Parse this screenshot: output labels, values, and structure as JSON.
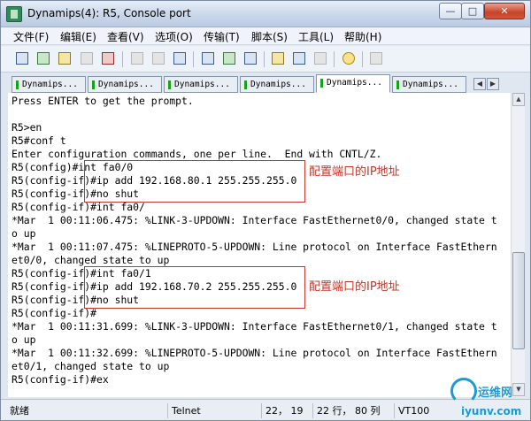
{
  "window": {
    "title": "Dynamips(4): R5, Console port",
    "buttons": {
      "minimize": "—",
      "maximize": "□",
      "close": "✕"
    }
  },
  "menu": {
    "items": [
      "文件(F)",
      "编辑(E)",
      "查看(V)",
      "选项(O)",
      "传输(T)",
      "脚本(S)",
      "工具(L)",
      "帮助(H)"
    ]
  },
  "toolbar": {
    "icons": [
      "connect-icon",
      "quick-connect-icon",
      "connect-tab-icon",
      "reconnect-icon",
      "disconnect-icon",
      "copy-icon",
      "paste-icon",
      "find-icon",
      "print-setup-icon",
      "print-icon",
      "print-screen-icon",
      "session-options-icon",
      "global-options-icon",
      "keymap-icon",
      "help-icon",
      "dim-icon"
    ]
  },
  "tabs": [
    {
      "label": "Dynamips...",
      "active": false
    },
    {
      "label": "Dynamips...",
      "active": false
    },
    {
      "label": "Dynamips...",
      "active": false
    },
    {
      "label": "Dynamips...",
      "active": false
    },
    {
      "label": "Dynamips...",
      "active": true
    },
    {
      "label": "Dynamips...",
      "active": false
    }
  ],
  "console": {
    "lines": [
      "Press ENTER to get the prompt.",
      "",
      "R5>en",
      "R5#conf t",
      "Enter configuration commands, one per line.  End with CNTL/Z.",
      "R5(config)#int fa0/0",
      "R5(config-if)#ip add 192.168.80.1 255.255.255.0",
      "R5(config-if)#no shut",
      "R5(config-if)#int fa0/",
      "*Mar  1 00:11:06.475: %LINK-3-UPDOWN: Interface FastEthernet0/0, changed state t",
      "o up",
      "*Mar  1 00:11:07.475: %LINEPROTO-5-UPDOWN: Line protocol on Interface FastEthern",
      "et0/0, changed state to up",
      "R5(config-if)#int fa0/1",
      "R5(config-if)#ip add 192.168.70.2 255.255.255.0",
      "R5(config-if)#no shut",
      "R5(config-if)#",
      "*Mar  1 00:11:31.699: %LINK-3-UPDOWN: Interface FastEthernet0/1, changed state t",
      "o up",
      "*Mar  1 00:11:32.699: %LINEPROTO-5-UPDOWN: Line protocol on Interface FastEthern",
      "et0/1, changed state to up",
      "R5(config-if)#ex"
    ],
    "annotations": [
      "配置端口的IP地址",
      "配置端口的IP地址"
    ],
    "annotation_color": "#c0392b"
  },
  "status": {
    "ready": "就绪",
    "protocol": "Telnet",
    "cursor": "22， 19",
    "size": "22 行， 80 列",
    "terminal": "VT100"
  },
  "watermark": {
    "name": "运维网",
    "url": "iyunv.com"
  }
}
